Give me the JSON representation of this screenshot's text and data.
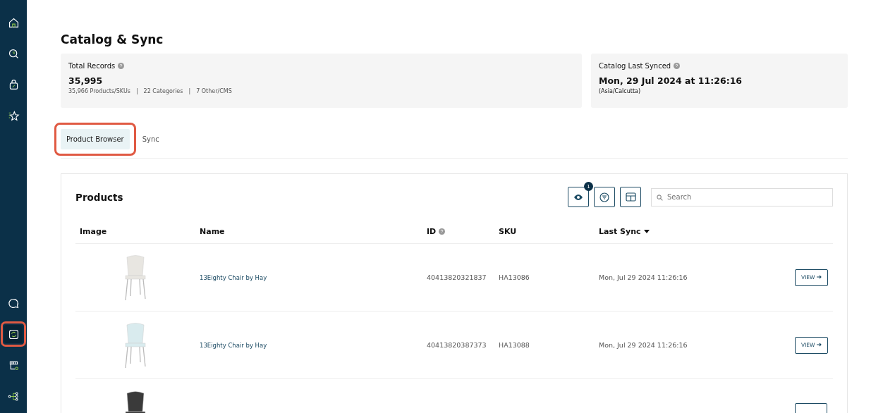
{
  "sidebar": {
    "items": [
      {
        "selected": false,
        "highlighted": false
      },
      {
        "selected": false,
        "highlighted": false
      },
      {
        "selected": false,
        "highlighted": false
      },
      {
        "selected": false,
        "highlighted": false
      }
    ],
    "bottom_items": [
      {
        "selected": false,
        "highlighted": false
      },
      {
        "selected": true,
        "highlighted": true
      },
      {
        "selected": false,
        "highlighted": false
      },
      {
        "selected": false,
        "highlighted": false
      }
    ]
  },
  "page_title": "Catalog & Sync",
  "stats": [
    {
      "label": "Total Records",
      "value": "35,995",
      "details": [
        "35,966 Products/SKUs",
        "22 Categories",
        "7 Other/CMS"
      ],
      "separator": "|"
    },
    {
      "label": "Catalog Last Synced",
      "value": "Mon, 29 Jul 2024 at 11:26:16",
      "note": "(Asia/Calcutta)"
    }
  ],
  "tabs": [
    {
      "label": "Product Browser",
      "selected": true,
      "highlighted": true
    },
    {
      "label": "Sync",
      "selected": false,
      "highlighted": false
    }
  ],
  "products": {
    "title": "Products",
    "visibility_badge": "1",
    "search": {
      "placeholder": "Search"
    },
    "columns": [
      {
        "label": "Image",
        "help": false,
        "sorted": false
      },
      {
        "label": "Name",
        "help": false,
        "sorted": false
      },
      {
        "label": "ID",
        "help": true,
        "sorted": false
      },
      {
        "label": "SKU",
        "help": false,
        "sorted": false
      },
      {
        "label": "Last Sync",
        "help": false,
        "sorted": true
      }
    ],
    "rows": [
      {
        "kind": "full",
        "name": "13Eighty Chair by Hay",
        "id": "40413820321837",
        "sku": "HA13086",
        "last_sync": "Mon, Jul 29 2024 11:26:16",
        "action": "VIEW"
      },
      {
        "kind": "full",
        "name": "13Eighty Chair by Hay",
        "id": "40413820387373",
        "sku": "HA13088",
        "last_sync": "Mon, Jul 29 2024 11:26:16",
        "action": "VIEW"
      },
      {
        "kind": "partial"
      }
    ]
  }
}
